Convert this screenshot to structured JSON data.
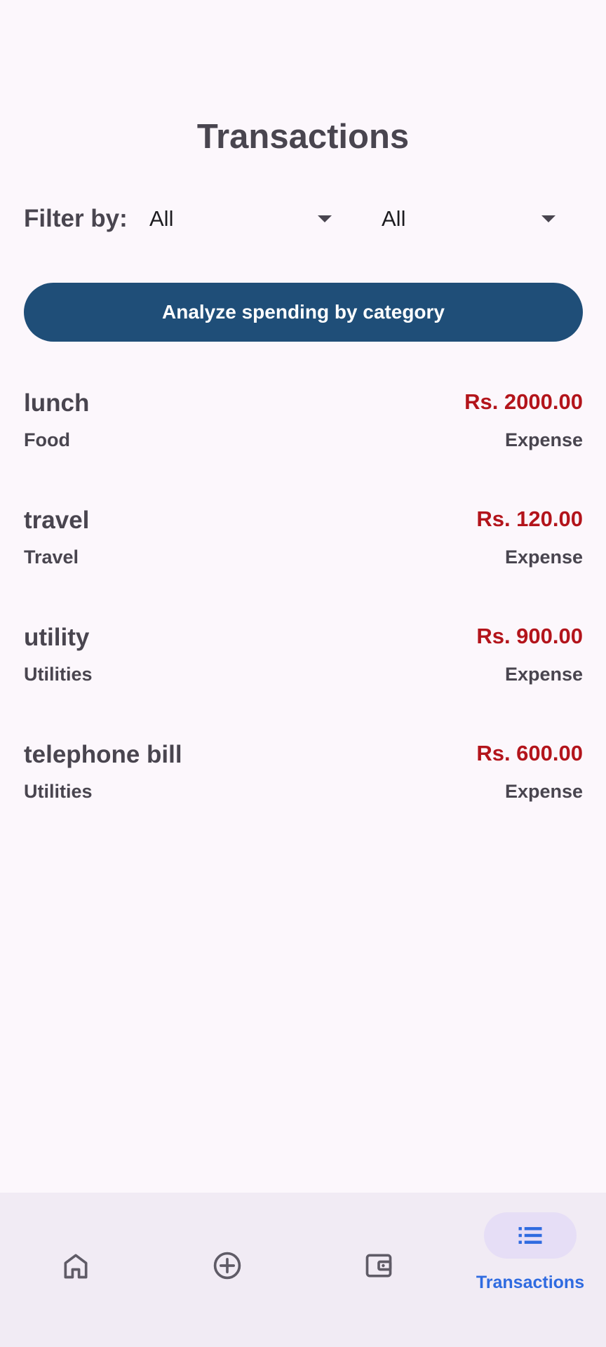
{
  "page": {
    "title": "Transactions"
  },
  "filter": {
    "label": "Filter by:",
    "first_value": "All",
    "second_value": "All"
  },
  "analyze_button": {
    "label": "Analyze spending by category"
  },
  "transactions": [
    {
      "name": "lunch",
      "amount": "Rs. 2000.00",
      "category": "Food",
      "type": "Expense"
    },
    {
      "name": "travel",
      "amount": "Rs. 120.00",
      "category": "Travel",
      "type": "Expense"
    },
    {
      "name": "utility",
      "amount": "Rs. 900.00",
      "category": "Utilities",
      "type": "Expense"
    },
    {
      "name": "telephone bill",
      "amount": "Rs. 600.00",
      "category": "Utilities",
      "type": "Expense"
    }
  ],
  "bottom_nav": {
    "items": [
      {
        "icon": "home-icon",
        "label": ""
      },
      {
        "icon": "add-circle-icon",
        "label": ""
      },
      {
        "icon": "wallet-icon",
        "label": ""
      },
      {
        "icon": "list-icon",
        "label": "Transactions",
        "active": true
      }
    ]
  },
  "colors": {
    "background": "#fcf7fc",
    "primary_button": "#1f4e78",
    "amount_red": "#b3141b",
    "nav_background": "#f1ebf4",
    "nav_active_pill": "#e6def6",
    "nav_active_label": "#2f6be0"
  }
}
